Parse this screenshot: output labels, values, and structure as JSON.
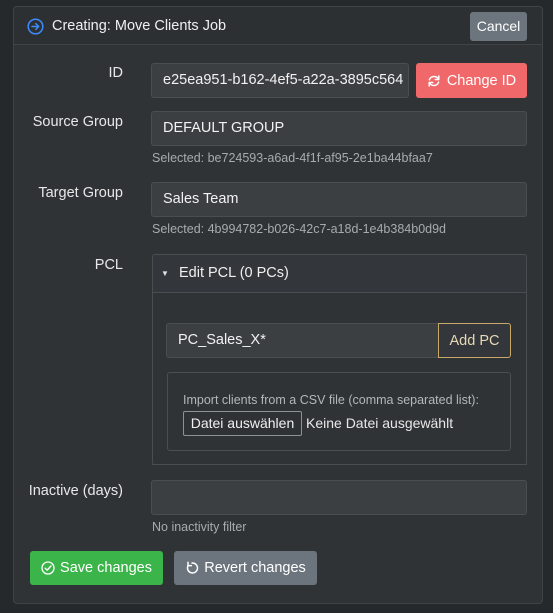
{
  "header": {
    "title": "Creating: Move Clients Job",
    "cancel_label": "Cancel",
    "icon": "arrow-circle-right-icon"
  },
  "form": {
    "id": {
      "label": "ID",
      "value": "e25ea951-b162-4ef5-a22a-3895c564",
      "change_label": "Change ID",
      "change_icon": "refresh-icon"
    },
    "source_group": {
      "label": "Source Group",
      "value": "DEFAULT GROUP",
      "help": "Selected: be724593-a6ad-4f1f-af95-2e1ba44bfaa7"
    },
    "target_group": {
      "label": "Target Group",
      "value": "Sales Team",
      "help": "Selected: 4b994782-b026-42c7-a18d-1e4b384b0d9d"
    },
    "pcl": {
      "label": "PCL",
      "summary": "Edit PCL (0 PCs)",
      "pc_input_value": "PC_Sales_X*",
      "add_label": "Add PC",
      "csv_label": "Import clients from a CSV file (comma separated list):",
      "file_button": "Datei auswählen",
      "file_status": "Keine Datei ausgewählt"
    },
    "inactive": {
      "label": "Inactive (days)",
      "value": "",
      "help": "No inactivity filter"
    }
  },
  "actions": {
    "save_label": "Save changes",
    "revert_label": "Revert changes"
  },
  "colors": {
    "background": "#26292c",
    "panel": "#303336",
    "danger": "#f0686a",
    "success": "#3bb54a",
    "secondary": "#6c757d",
    "accent_icon": "#3d8bfd",
    "warning_outline": "#c9a96a"
  }
}
